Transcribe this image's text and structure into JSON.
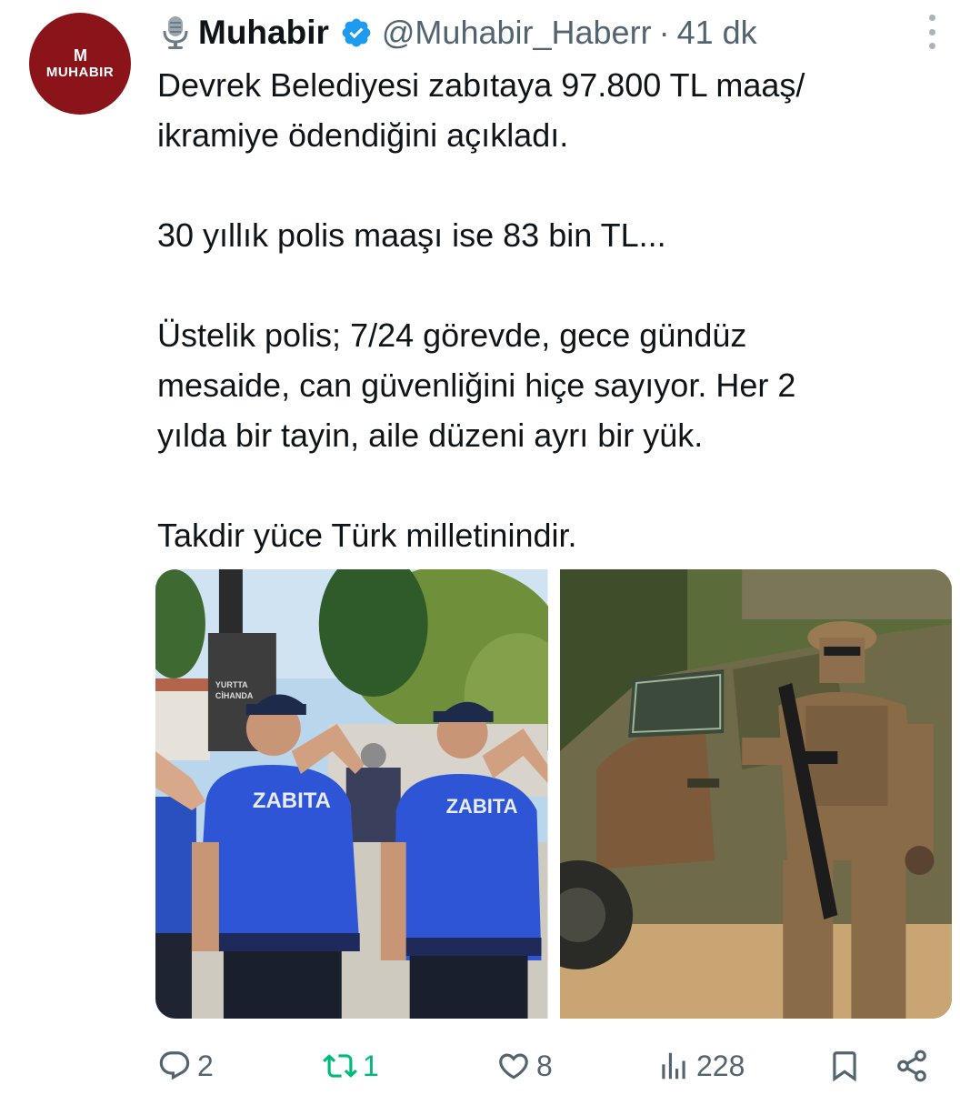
{
  "author": {
    "avatar_mark": "M",
    "avatar_wordmark": "MUHABIR",
    "name": "Muhabir",
    "handle": "@Muhabir_Haberr",
    "separator": "·",
    "time": "41 dk",
    "verified_color": "#1d9bf0"
  },
  "tweet": {
    "lines": [
      "Devrek Belediyesi zabıtaya 97.800 TL maaş/",
      "ikramiye ödendiğini açıkladı.",
      "",
      "30 yıllık polis maaşı ise 83 bin TL...",
      "",
      "Üstelik polis; 7/24 görevde, gece gündüz",
      "mesaide, can güvenliğini hiçe sayıyor. Her 2",
      "yılda bir tayin, aile düzeni ayrı bir yük.",
      "",
      "Takdir yüce Türk milletinindir."
    ]
  },
  "media": {
    "left_image": {
      "icon": "photo-municipal-officers-saluting",
      "monument_text_1": "YURTTA",
      "monument_text_2": "CİHANDA",
      "vest_text": "ZABITA"
    },
    "right_image": {
      "icon": "photo-armed-police-armored-vehicle"
    }
  },
  "actions": {
    "reply_count": "2",
    "retweet_count": "1",
    "like_count": "8",
    "views_count": "228"
  },
  "colors": {
    "text": "#0f1419",
    "muted": "#536471",
    "retweet_green": "#00ba7c",
    "avatar_bg": "#8a1419"
  }
}
